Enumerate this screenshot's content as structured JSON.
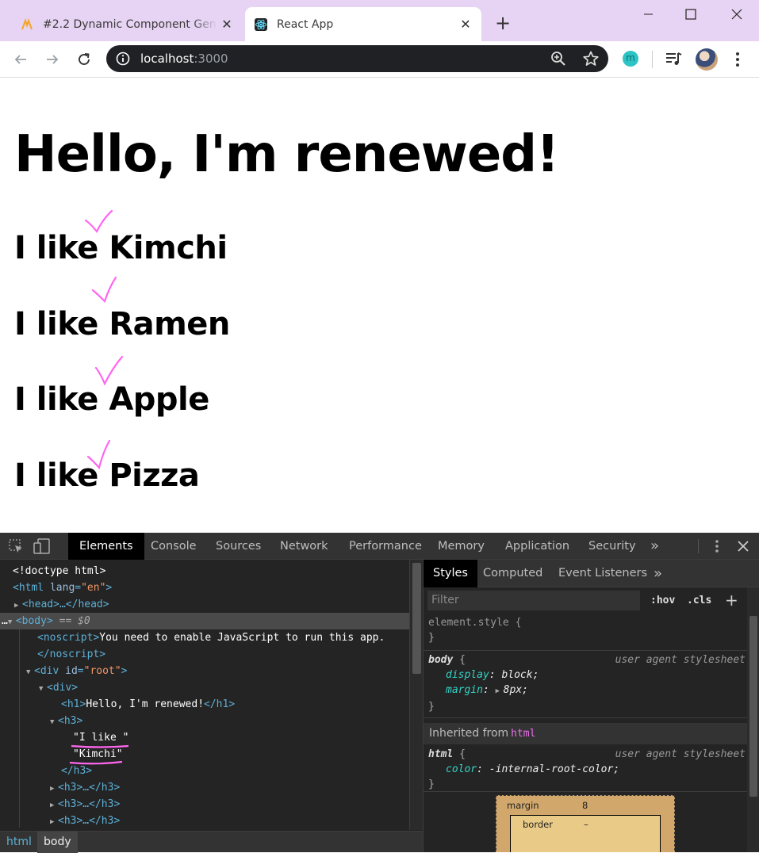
{
  "browser": {
    "tabs": [
      {
        "title": "#2.2 Dynamic Component Gene",
        "icon": "nomad-coders-icon",
        "active": false
      },
      {
        "title": "React App",
        "icon": "react-icon",
        "active": true
      }
    ],
    "close_glyph": "✕",
    "new_tab_glyph": "+",
    "url_host": "localhost",
    "url_port": ":3000",
    "extension_letter": "m",
    "accent_tab_bar": "#e7d3f3"
  },
  "page": {
    "heading": "Hello, I'm renewed!",
    "items": [
      "I like Kimchi",
      "I like Ramen",
      "I like Apple",
      "I like Pizza"
    ],
    "annotation_color": "#ff66f0"
  },
  "devtools": {
    "tabs": [
      "Elements",
      "Console",
      "Sources",
      "Network",
      "Performance",
      "Memory",
      "Application",
      "Security"
    ],
    "more_glyph": "»",
    "dom": {
      "doctype": "<!doctype html>",
      "html_open": "<html",
      "lang_attr": "lang",
      "lang_val": "\"en\"",
      "gt": ">",
      "head": "<head>…</head>",
      "ellipsis": "…",
      "body_open": "<body>",
      "body_eq": " == $0",
      "noscript_open": "<noscript>",
      "noscript_text": "You need to enable JavaScript to run this app.",
      "noscript_close": "</noscript>",
      "div_root_open": "<div",
      "id_attr": "id",
      "id_val": "\"root\"",
      "div_open": "<div>",
      "h1_open": "<h1>",
      "h1_text": "Hello, I'm renewed!",
      "h1_close": "</h1>",
      "h3_open": "<h3>",
      "h3_text1": "\"I like \"",
      "h3_text2": "\"Kimchi\"",
      "h3_close": "</h3>",
      "h3_collapsed": "<h3>…</h3>"
    },
    "breadcrumbs": [
      "html",
      "body"
    ],
    "styles_tabs": [
      "Styles",
      "Computed",
      "Event Listeners"
    ],
    "filter_placeholder": "Filter",
    "hov": ":hov",
    "cls": ".cls",
    "add": "+",
    "element_style": "element.style {",
    "close_brace": "}",
    "body_rule": {
      "selector": "body",
      "source": "user agent stylesheet",
      "props": [
        {
          "name": "display",
          "value": "block;"
        },
        {
          "name": "margin",
          "value": "8px;"
        }
      ]
    },
    "inherited_label": "Inherited from",
    "inherited_tag": "html",
    "html_rule": {
      "selector": "html",
      "source": "user agent stylesheet",
      "props": [
        {
          "name": "color",
          "value": "-internal-root-color;"
        }
      ]
    },
    "box_model": {
      "margin_label": "margin",
      "margin_value": "8",
      "border_label": "border",
      "border_value": "–"
    }
  }
}
